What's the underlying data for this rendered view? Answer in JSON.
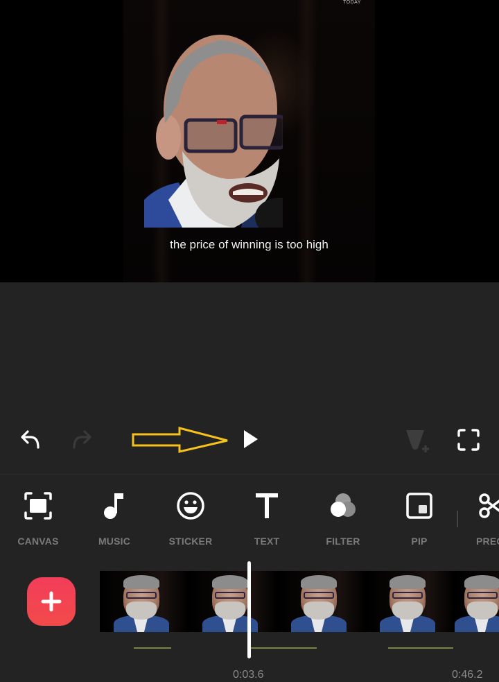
{
  "preview": {
    "caption": "the price of winning is too high",
    "watermark": "TODAY"
  },
  "controls": {
    "undo": "undo-icon",
    "redo": "redo-icon",
    "play": "play-icon",
    "keyframe": "add-keyframe-icon",
    "fullscreen": "fullscreen-icon",
    "annotation_color": "#f7c21b"
  },
  "toolbar": {
    "items": [
      {
        "label": "CANVAS",
        "icon": "canvas-icon"
      },
      {
        "label": "MUSIC",
        "icon": "music-note-icon"
      },
      {
        "label": "STICKER",
        "icon": "smiley-icon"
      },
      {
        "label": "TEXT",
        "icon": "text-icon"
      },
      {
        "label": "FILTER",
        "icon": "filter-icon"
      },
      {
        "label": "PIP",
        "icon": "pip-icon"
      },
      {
        "label": "PREC",
        "icon": "scissors-icon"
      }
    ]
  },
  "timeline": {
    "add_button_color": "#f2425a",
    "current_time": "0:03.6",
    "total_time": "0:46.2",
    "thumbnail_count": 5
  }
}
